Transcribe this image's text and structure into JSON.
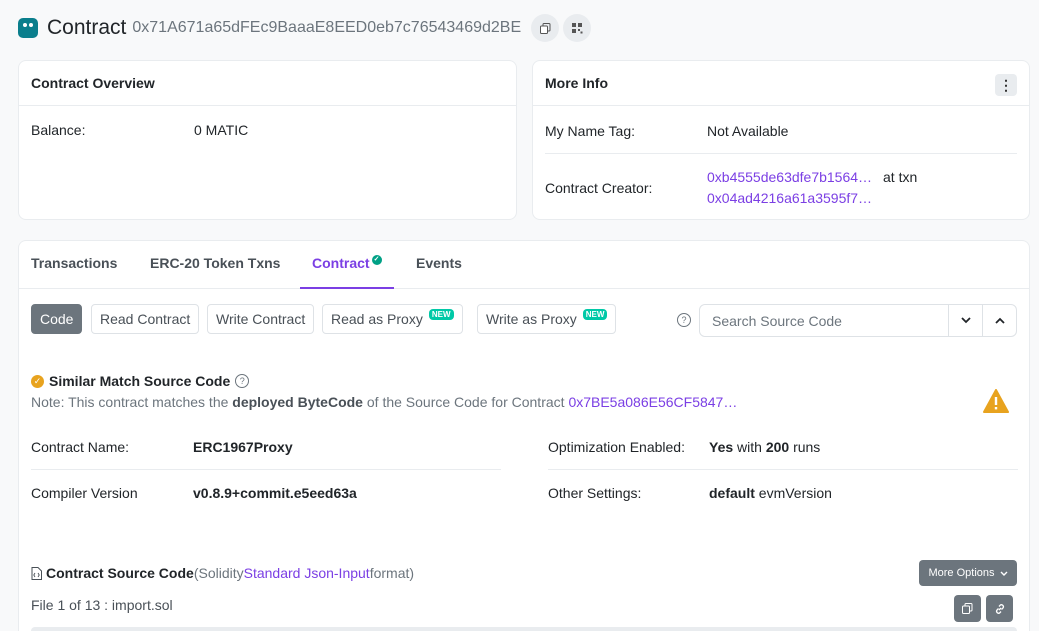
{
  "header": {
    "title": "Contract",
    "address": "0x71A671a65dFEc9BaaaE8EED0eb7c76543469d2BE",
    "copy_icon": "copy-icon",
    "qr_icon": "qr-code-icon"
  },
  "overview": {
    "title": "Contract Overview",
    "balance_label": "Balance:",
    "balance_value": "0 MATIC"
  },
  "more_info": {
    "title": "More Info",
    "name_tag_label": "My Name Tag:",
    "name_tag_value": "Not Available",
    "creator_label": "Contract Creator:",
    "creator_address": "0xb4555de63dfe7b1564…",
    "at_txn": "at txn",
    "creator_txn": "0x04ad4216a61a3595f7…"
  },
  "tabs": [
    {
      "label": "Transactions"
    },
    {
      "label": "ERC-20 Token Txns"
    },
    {
      "label": "Contract",
      "active": true
    },
    {
      "label": "Events"
    }
  ],
  "contract_buttons": [
    {
      "label": "Code",
      "active": true
    },
    {
      "label": "Read Contract"
    },
    {
      "label": "Write Contract"
    },
    {
      "label": "Read as Proxy",
      "badge": "NEW"
    },
    {
      "label": "Write as Proxy",
      "badge": "NEW"
    }
  ],
  "search": {
    "placeholder": "Search Source Code"
  },
  "match": {
    "title": "Similar Match Source Code",
    "note_prefix": "Note: This contract matches the ",
    "note_bold": "deployed ByteCode",
    "note_middle": " of the Source Code for Contract ",
    "note_link": "0x7BE5a086E56CF5847…"
  },
  "details": {
    "name_label": "Contract Name:",
    "name_value": "ERC1967Proxy",
    "compiler_label": "Compiler Version",
    "compiler_value": "v0.8.9+commit.e5eed63a",
    "opt_label": "Optimization Enabled:",
    "opt_yes": "Yes",
    "opt_with": " with ",
    "opt_runs": "200",
    "opt_runs_suffix": " runs",
    "other_label": "Other Settings:",
    "other_bold": "default",
    "other_rest": " evmVersion"
  },
  "source": {
    "title": "Contract Source Code",
    "paren_open": " (Solidity ",
    "link": "Standard Json-Input",
    "paren_close": " format)",
    "more_options": "More Options",
    "file_label": "File 1 of 13 : import.sol"
  },
  "colors": {
    "accent": "#7b3fe4",
    "warning": "#e8a31f",
    "new_badge": "#00c9a7"
  }
}
